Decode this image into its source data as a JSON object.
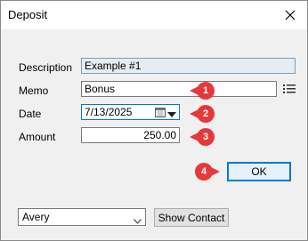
{
  "window": {
    "title": "Deposit"
  },
  "form": {
    "description": {
      "label": "Description",
      "value": "Example #1"
    },
    "memo": {
      "label": "Memo",
      "value": "Bonus"
    },
    "date": {
      "label": "Date",
      "value": "7/13/2025"
    },
    "amount": {
      "label": "Amount",
      "value": "250.00"
    }
  },
  "badges": [
    "1",
    "2",
    "3",
    "4"
  ],
  "buttons": {
    "ok": "OK",
    "show_contact": "Show Contact"
  },
  "contact": {
    "selected": "Avery"
  },
  "colors": {
    "badge": "#e5383b",
    "accent": "#0078d7"
  }
}
